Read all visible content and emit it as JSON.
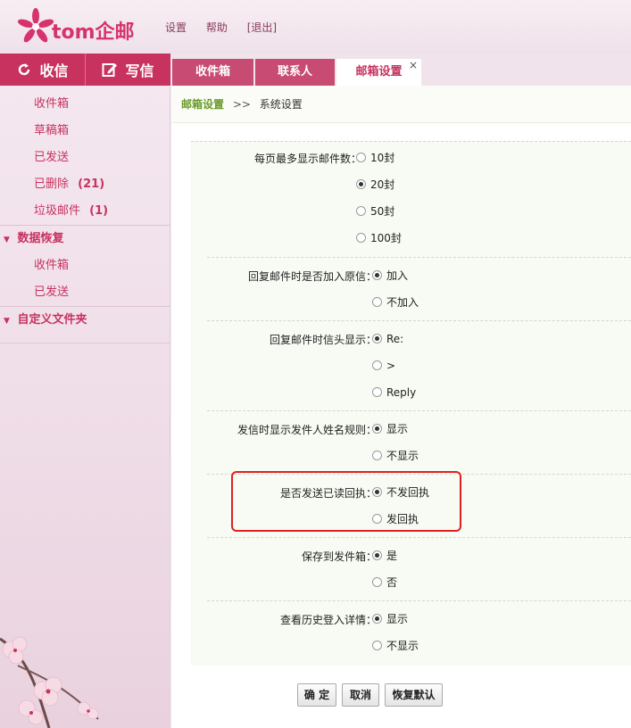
{
  "header": {
    "logo_text": "tom企邮",
    "links": [
      "设置",
      "帮助",
      "[退出]"
    ]
  },
  "nav": {
    "receive": "收信",
    "compose": "写信"
  },
  "tabs": [
    "收件箱",
    "联系人",
    "邮箱设置"
  ],
  "active_tab_close": "×",
  "sidebar": {
    "items": [
      {
        "label": "收件箱",
        "count": ""
      },
      {
        "label": "草稿箱",
        "count": ""
      },
      {
        "label": "已发送",
        "count": ""
      },
      {
        "label": "已删除",
        "count": "(21)"
      },
      {
        "label": "垃圾邮件",
        "count": "(1)"
      }
    ],
    "group_recovery": "数据恢复",
    "recovery_items": [
      "收件箱",
      "已发送"
    ],
    "group_custom": "自定义文件夹"
  },
  "breadcrumb": {
    "root": "邮箱设置",
    "separator": ">>",
    "current": "系统设置"
  },
  "settings": [
    {
      "label": "每页最多显示邮件数：",
      "options": [
        "10封",
        "20封",
        "50封",
        "100封"
      ],
      "selected": 1
    },
    {
      "label": "回复邮件时是否加入原信：",
      "options": [
        "加入",
        "不加入"
      ],
      "selected": 0
    },
    {
      "label": "回复邮件时信头显示：",
      "options": [
        "Re:",
        ">",
        "Reply"
      ],
      "selected": 0
    },
    {
      "label": "发信时显示发件人姓名规则：",
      "options": [
        "显示",
        "不显示"
      ],
      "selected": 0
    },
    {
      "label": "是否发送已读回执：",
      "options": [
        "不发回执",
        "发回执"
      ],
      "selected": 0
    },
    {
      "label": "保存到发件箱：",
      "options": [
        "是",
        "否"
      ],
      "selected": 0
    },
    {
      "label": "查看历史登入详情：",
      "options": [
        "显示",
        "不显示"
      ],
      "selected": 0
    }
  ],
  "buttons": {
    "ok": "确 定",
    "cancel": "取消",
    "restore": "恢复默认"
  },
  "colors": {
    "brand": "#c8325f",
    "breadcrumb_link": "#6a9a2a",
    "highlight": "#e02020"
  }
}
